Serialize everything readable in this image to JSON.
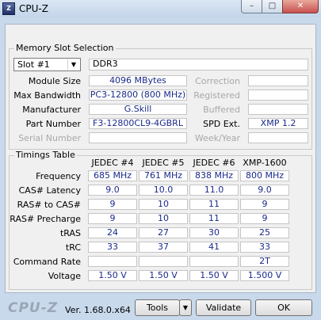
{
  "window": {
    "title": "CPU-Z",
    "icon": "cpuz-app-icon",
    "min": "–",
    "max": "□",
    "close": "✕"
  },
  "slot_section": {
    "title": "Memory Slot Selection",
    "slot_select": "Slot #1",
    "memory_type": "DDR3",
    "rows": [
      {
        "label": "Module Size",
        "value": "4096 MBytes",
        "rlabel": "Correction",
        "rvalue": ""
      },
      {
        "label": "Max Bandwidth",
        "value": "PC3-12800 (800 MHz)",
        "rlabel": "Registered",
        "rvalue": ""
      },
      {
        "label": "Manufacturer",
        "value": "G.Skill",
        "rlabel": "Buffered",
        "rvalue": ""
      },
      {
        "label": "Part Number",
        "value": "F3-12800CL9-4GBRL",
        "rlabel": "SPD Ext.",
        "rvalue": "XMP 1.2"
      },
      {
        "label": "Serial Number",
        "value": "",
        "rlabel": "Week/Year",
        "rvalue": ""
      }
    ]
  },
  "timings": {
    "title": "Timings Table",
    "columns": [
      "JEDEC #4",
      "JEDEC #5",
      "JEDEC #6",
      "XMP-1600"
    ],
    "rows": [
      {
        "label": "Frequency",
        "values": [
          "685 MHz",
          "761 MHz",
          "838 MHz",
          "800 MHz"
        ]
      },
      {
        "label": "CAS# Latency",
        "values": [
          "9.0",
          "10.0",
          "11.0",
          "9.0"
        ]
      },
      {
        "label": "RAS# to CAS#",
        "values": [
          "9",
          "10",
          "11",
          "9"
        ]
      },
      {
        "label": "RAS# Precharge",
        "values": [
          "9",
          "10",
          "11",
          "9"
        ]
      },
      {
        "label": "tRAS",
        "values": [
          "24",
          "27",
          "30",
          "25"
        ]
      },
      {
        "label": "tRC",
        "values": [
          "33",
          "37",
          "41",
          "33"
        ]
      },
      {
        "label": "Command Rate",
        "values": [
          "",
          "",
          "",
          "2T"
        ]
      },
      {
        "label": "Voltage",
        "values": [
          "1.50 V",
          "1.50 V",
          "1.50 V",
          "1.500 V"
        ]
      }
    ]
  },
  "footer": {
    "logo": "CPU-Z",
    "version": "Ver. 1.68.0.x64",
    "tools_label": "Tools",
    "tools_arrow": "▼",
    "validate_label": "Validate",
    "ok_label": "OK"
  }
}
